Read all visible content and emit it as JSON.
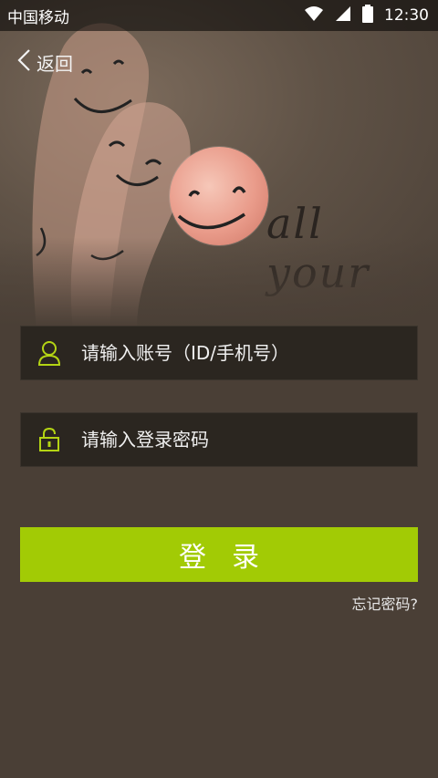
{
  "status_bar": {
    "carrier": "中国移动",
    "time": "12:30",
    "icons": [
      "wifi-icon",
      "signal-icon",
      "battery-icon"
    ]
  },
  "header": {
    "back_label": "返回",
    "back_icon": "chevron-left-icon"
  },
  "hero": {
    "handwritten_text": "all your"
  },
  "form": {
    "account_placeholder": "请输入账号（ID/手机号）",
    "account_icon": "user-icon",
    "password_placeholder": "请输入登录密码",
    "password_icon": "lock-icon",
    "login_label": "登录",
    "forgot_label": "忘记密码?"
  },
  "colors": {
    "background": "#4a3f36",
    "field_background": "#2b2620",
    "accent": "#a2cb05",
    "icon_accent": "#b4d414"
  }
}
